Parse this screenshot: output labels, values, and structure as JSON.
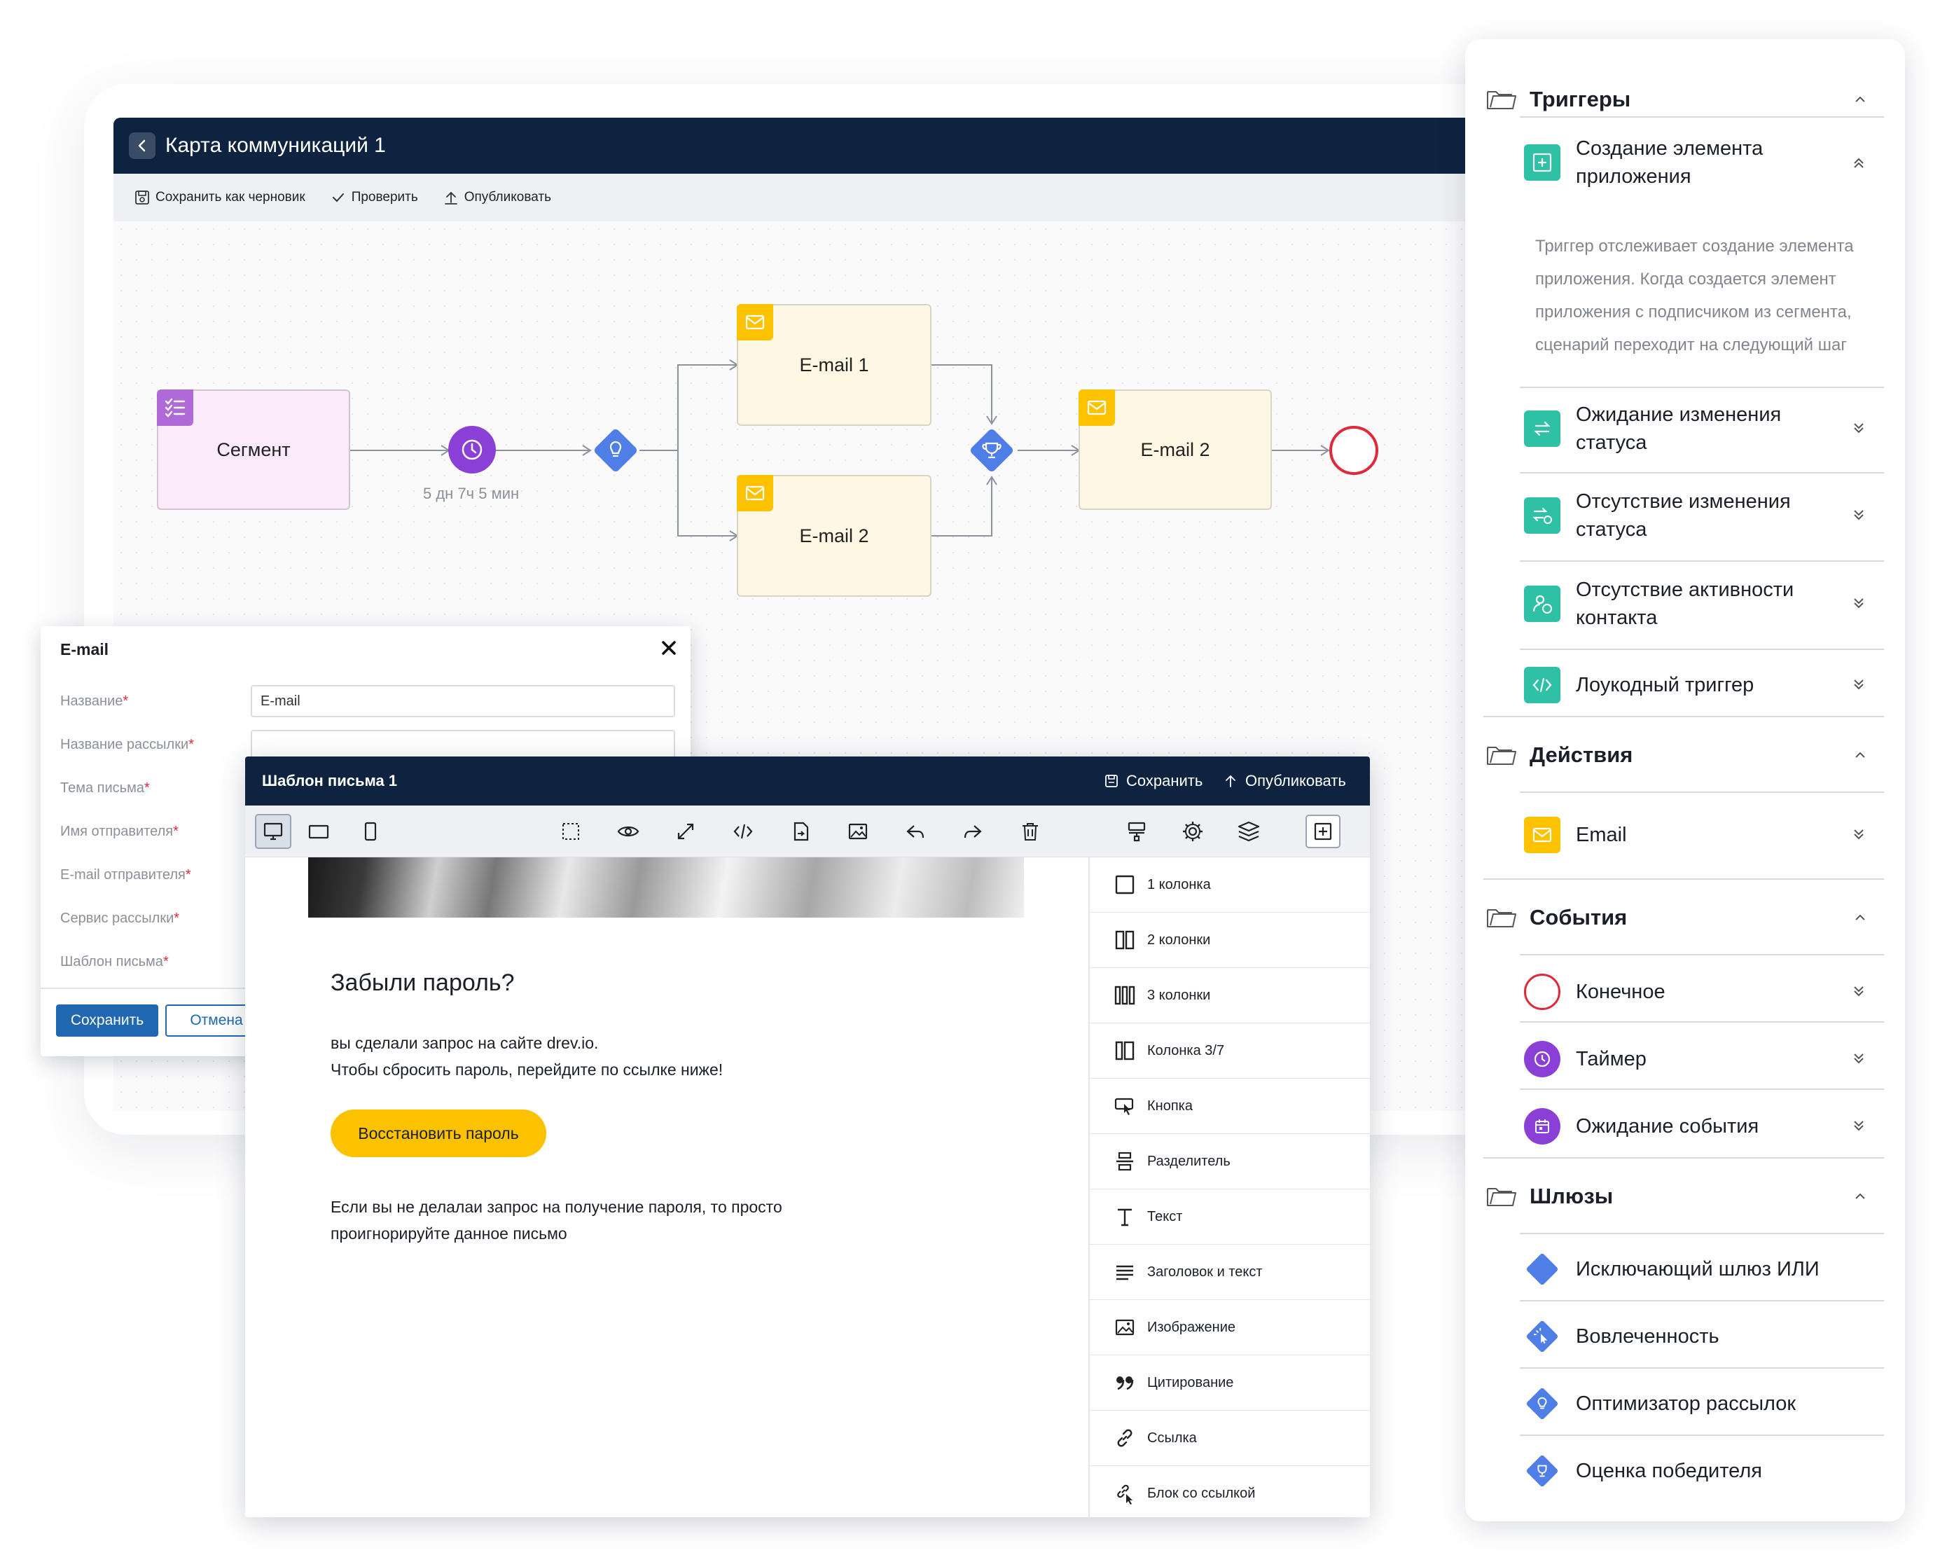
{
  "flow": {
    "title": "Карта коммуникаций 1",
    "toolbar": {
      "save_draft": "Сохранить как черновик",
      "check": "Проверить",
      "publish": "Опубликовать"
    },
    "nodes": {
      "segment": "Сегмент",
      "email1": "E-mail 1",
      "email2": "E-mail 2",
      "email3": "E-mail 2"
    },
    "delay_label": "5 дн 7ч 5 мин"
  },
  "panel": {
    "triggers": {
      "title": "Триггеры",
      "items": [
        "Создание элемента приложения",
        "Ожидание изменения статуса",
        "Отсутствие изменения статуса",
        "Отсутствие активности контакта",
        "Лоукодный триггер"
      ],
      "description": "Триггер отслеживает создание элемента приложения. Когда создается элемент приложения с подписчиком из сегмента, сценарий переходит на следующий шаг"
    },
    "actions": {
      "title": "Действия",
      "items": [
        "Email"
      ]
    },
    "events": {
      "title": "События",
      "items": [
        "Конечное",
        "Таймер",
        "Ожидание события"
      ]
    },
    "gateways": {
      "title": "Шлюзы",
      "items": [
        "Исключающий шлюз ИЛИ",
        "Вовлеченность",
        "Оптимизатор рассылок",
        "Оценка победителя"
      ]
    }
  },
  "email_dialog": {
    "title": "E-mail",
    "fields": {
      "name": {
        "label": "Название",
        "value": "E-mail"
      },
      "mailing_name": {
        "label": "Название рассылки",
        "value": ""
      },
      "subject": {
        "label": "Тема письма"
      },
      "sender_name": {
        "label": "Имя отправителя"
      },
      "sender_email": {
        "label": "E-mail отправителя"
      },
      "service": {
        "label": "Сервис рассылки"
      },
      "template": {
        "label": "Шаблон письма"
      }
    },
    "required_mark": "*",
    "save": "Сохранить",
    "cancel": "Отмена"
  },
  "template": {
    "title": "Шаблон письма 1",
    "save": "Сохранить",
    "publish": "Опубликовать",
    "heading": "Забыли пароль?",
    "text1": "вы сделали запрос на сайте drev.io.",
    "text2": "Чтобы сбросить пароль, перейдите по ссылке ниже!",
    "cta": "Восстановить пароль",
    "text3": "Если вы не делалаи запрос на получение пароля, то просто проигнорируйте данное письмо",
    "blocks": [
      "1 колонка",
      "2 колонки",
      "3 колонки",
      "Колонка 3/7",
      "Кнопка",
      "Разделитель",
      "Текст",
      "Заголовок и текст",
      "Изображение",
      "Цитирование",
      "Ссылка",
      "Блок со ссылкой"
    ]
  },
  "colors": {
    "header_navy": "#0e2340",
    "accent_yellow": "#fcc200",
    "primary_blue": "#1f67b0",
    "trigger_teal": "#2fc1a6",
    "gateway_blue": "#4f7ee6",
    "event_purple": "#8a3fd6",
    "end_red": "#e0293b",
    "segment_purple": "#b06ad8"
  }
}
